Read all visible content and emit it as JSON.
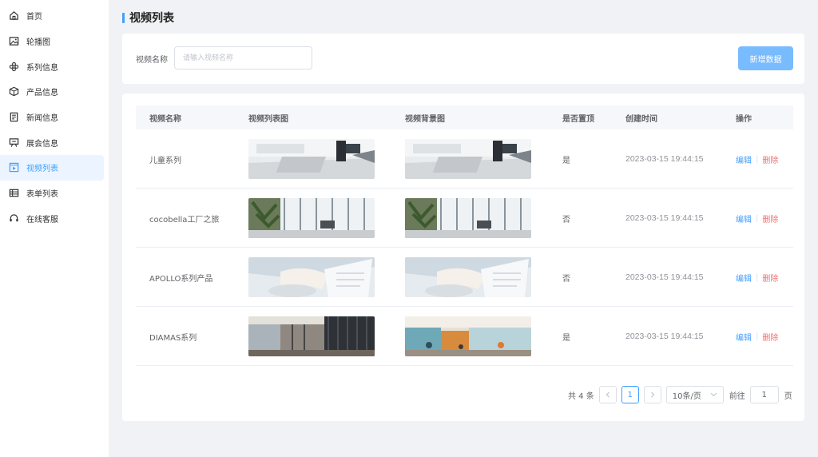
{
  "sidebar": {
    "items": [
      {
        "label": "首页",
        "icon": "home-icon"
      },
      {
        "label": "轮播图",
        "icon": "image-icon"
      },
      {
        "label": "系列信息",
        "icon": "layers-icon"
      },
      {
        "label": "产品信息",
        "icon": "box-icon"
      },
      {
        "label": "新闻信息",
        "icon": "document-icon"
      },
      {
        "label": "展会信息",
        "icon": "exhibition-icon"
      },
      {
        "label": "视频列表",
        "icon": "video-icon"
      },
      {
        "label": "表单列表",
        "icon": "table-icon"
      },
      {
        "label": "在线客服",
        "icon": "headset-icon"
      }
    ],
    "active_index": 6
  },
  "page": {
    "title": "视频列表"
  },
  "search": {
    "label": "视频名称",
    "placeholder": "请输入视频名称",
    "add_button": "新增数据"
  },
  "table": {
    "columns": [
      "视频名称",
      "视频列表图",
      "视频背景图",
      "是否置顶",
      "创建时间",
      "操作"
    ],
    "rows": [
      {
        "name": "儿童系列",
        "top": "是",
        "time": "2023-03-15 19:44:15",
        "edit": "编辑",
        "delete": "删除"
      },
      {
        "name": "cocobella工厂之旅",
        "top": "否",
        "time": "2023-03-15 19:44:15",
        "edit": "编辑",
        "delete": "删除"
      },
      {
        "name": "APOLLO系列产品",
        "top": "否",
        "time": "2023-03-15 19:44:15",
        "edit": "编辑",
        "delete": "删除"
      },
      {
        "name": "DIAMAS系列",
        "top": "是",
        "time": "2023-03-15 19:44:15",
        "edit": "编辑",
        "delete": "删除"
      }
    ]
  },
  "pagination": {
    "total": "共 4 条",
    "current": "1",
    "page_size": "10条/页",
    "goto_label": "前往",
    "goto_value": "1",
    "page_suffix": "页"
  },
  "colors": {
    "primary": "#409eff",
    "danger": "#f56c6c",
    "sidebar_active_bg": "#ecf5ff"
  }
}
